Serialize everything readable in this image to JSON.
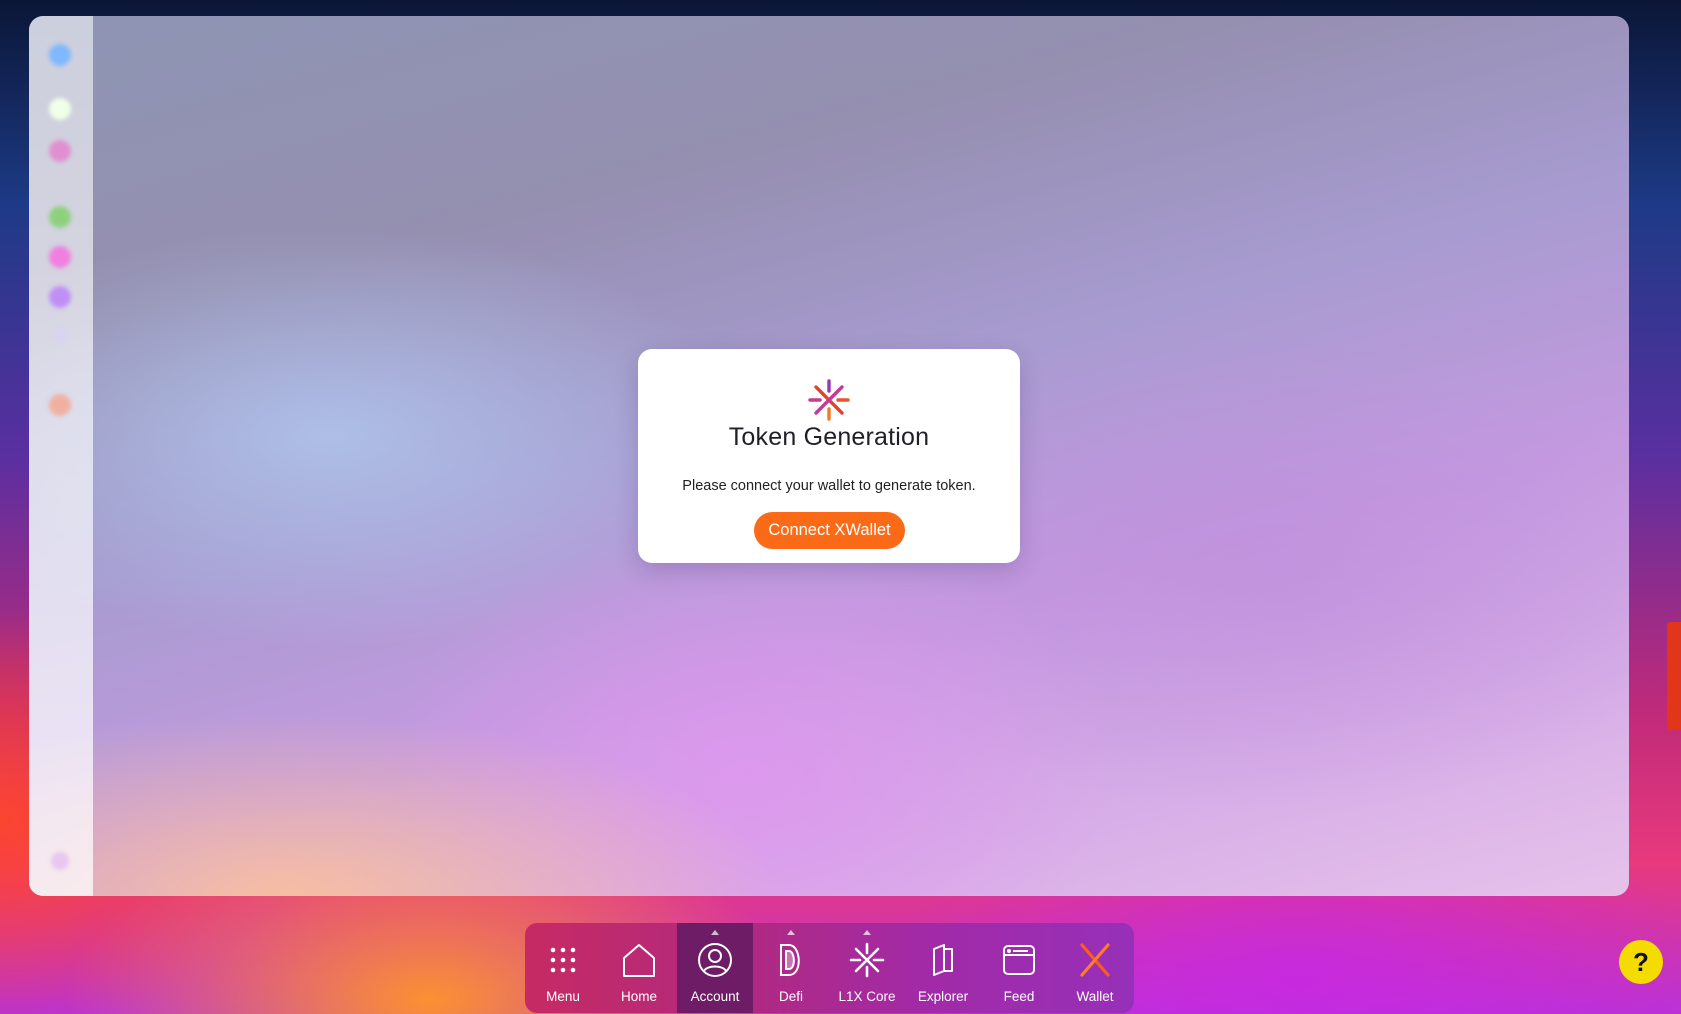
{
  "modal": {
    "title": "Token Generation",
    "message": "Please connect your wallet to generate token.",
    "button_label": "Connect XWallet",
    "button_color": "#fb6a16"
  },
  "dock": {
    "items": [
      {
        "label": "Menu",
        "icon": "grid-icon"
      },
      {
        "label": "Home",
        "icon": "home-icon"
      },
      {
        "label": "Account",
        "icon": "user-circle-icon",
        "active": true
      },
      {
        "label": "Defi",
        "icon": "defi-icon"
      },
      {
        "label": "L1X Core",
        "icon": "l1x-icon"
      },
      {
        "label": "Explorer",
        "icon": "explorer-icon"
      },
      {
        "label": "Feed",
        "icon": "feed-icon"
      },
      {
        "label": "Wallet",
        "icon": "x-wallet-icon"
      }
    ]
  },
  "help": {
    "label": "?"
  },
  "colors": {
    "accent": "#fb6a16",
    "help": "#f5dc00",
    "dock_active": "#6e1c66"
  }
}
